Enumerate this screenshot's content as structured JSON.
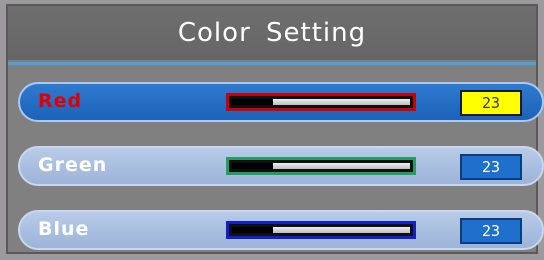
{
  "title": "Color Setting",
  "colors": {
    "highlight_row": "#1c62b8",
    "normal_row": "#a8bee0",
    "selected_value_bg": "#ffff00",
    "value_bg": "#1f6fcc"
  },
  "settings": [
    {
      "label": "Red",
      "value": "23",
      "level": 0.23,
      "bar_border": "#d00000",
      "bar_fill": "#d00000",
      "selected": true
    },
    {
      "label": "Green",
      "value": "23",
      "level": 0.23,
      "bar_border": "#1fa060",
      "bar_fill": "#2f7fbf",
      "selected": false
    },
    {
      "label": "Blue",
      "value": "23",
      "level": 0.23,
      "bar_border": "#1020d0",
      "bar_fill": "#2f7fbf",
      "selected": false
    }
  ]
}
